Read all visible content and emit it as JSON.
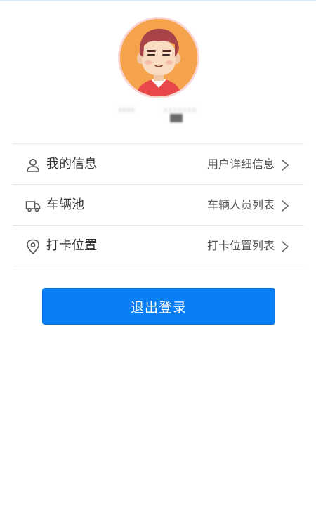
{
  "profile": {
    "avatar_icon": "cartoon-boy-avatar-icon",
    "user_name": "XXXX",
    "user_id": "XXXXXXX"
  },
  "menu": {
    "items": [
      {
        "label": "我的信息",
        "detail": "用户详细信息",
        "icon": "user-icon"
      },
      {
        "label": "车辆池",
        "detail": "车辆人员列表",
        "icon": "truck-icon"
      },
      {
        "label": "打卡位置",
        "detail": "打卡位置列表",
        "icon": "location-pin-icon"
      }
    ]
  },
  "logout": {
    "label": "退出登录"
  },
  "colors": {
    "accent": "#0a7ff5",
    "avatar_background": "#f5a34c",
    "divider": "#e6e6e6"
  }
}
